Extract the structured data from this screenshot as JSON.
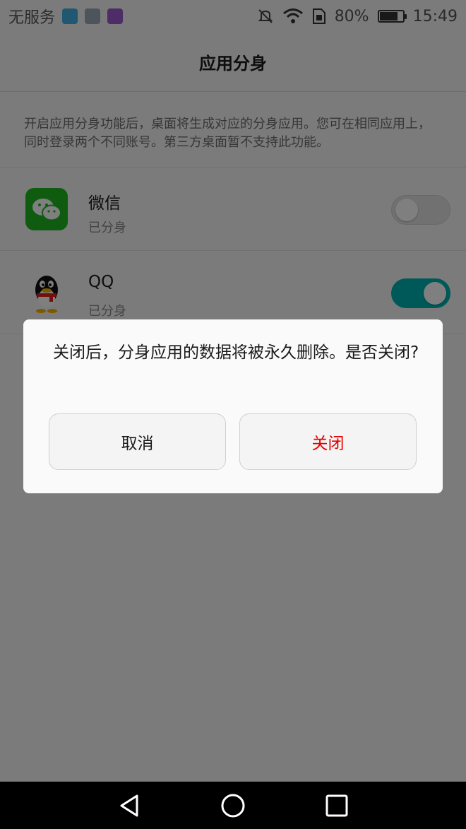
{
  "status_bar": {
    "carrier": "无服务",
    "battery": "80%",
    "battery_level": 0.8,
    "time": "15:49",
    "notification_icons": [
      "health-icon",
      "gallery-icon",
      "keyboard-icon"
    ],
    "system_icons": [
      "mute-icon",
      "wifi-icon",
      "sim-icon",
      "battery-icon"
    ]
  },
  "header": {
    "title": "应用分身"
  },
  "description": "开启应用分身功能后，桌面将生成对应的分身应用。您可在相同应用上，同时登录两个不同账号。第三方桌面暂不支持此功能。",
  "apps": [
    {
      "name": "微信",
      "status": "已分身",
      "enabled": false,
      "icon": "wechat-icon"
    },
    {
      "name": "QQ",
      "status": "已分身",
      "enabled": true,
      "icon": "qq-icon"
    }
  ],
  "dialog": {
    "message": "关闭后，分身应用的数据将被永久删除。是否关闭?",
    "cancel_label": "取消",
    "confirm_label": "关闭"
  },
  "nav_bar": {
    "buttons": [
      "back-icon",
      "home-icon",
      "recents-icon"
    ]
  },
  "colors": {
    "accent": "#00b2b2",
    "danger": "#e60000",
    "wechat": "#1fb922"
  }
}
